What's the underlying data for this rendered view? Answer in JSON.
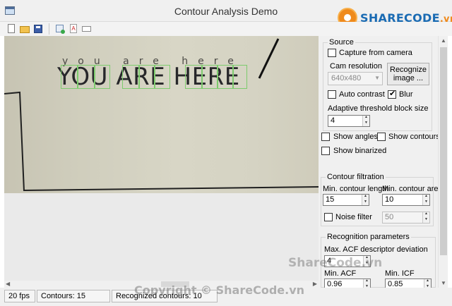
{
  "window": {
    "title": "Contour Analysis Demo",
    "logo": {
      "brand": "SHARECODE",
      "suffix": ".vn"
    }
  },
  "toolbar": {
    "items": [
      "new-file-icon",
      "open-folder-icon",
      "save-icon",
      "add-template-icon",
      "text-template-icon",
      "window-icon"
    ]
  },
  "image": {
    "small_text": "you are here",
    "big_text": "YOU ARE HERE"
  },
  "source": {
    "title": "Source",
    "capture_label": "Capture from camera",
    "capture_checked": false,
    "cam_resolution_label": "Cam resolution",
    "cam_resolution_value": "640x480",
    "recognize_button": "Recognize image ...",
    "auto_contrast_label": "Auto contrast",
    "auto_contrast_checked": false,
    "blur_label": "Blur",
    "blur_checked": true,
    "threshold_label": "Adaptive threshold block size",
    "threshold_value": "4"
  },
  "display": {
    "show_angles": "Show angles",
    "show_contours": "Show contours",
    "show_binarized": "Show binarized"
  },
  "filtration": {
    "title": "Contour filtration",
    "min_length_label": "Min. contour length",
    "min_length_value": "15",
    "min_area_label": "Min. contour area",
    "min_area_value": "10",
    "noise_filter_label": "Noise filter",
    "noise_filter_value": "50"
  },
  "recognition": {
    "title": "Recognition parameters",
    "max_acf_label": "Max. ACF descriptor deviation",
    "max_acf_value": "4",
    "min_acf_label": "Min. ACF",
    "min_acf_value": "0.96",
    "min_icf_label": "Min. ICF",
    "min_icf_value": "0.85"
  },
  "status": {
    "fps": "20 fps",
    "contours": "Contours: 15",
    "recognized": "Recognized contours: 10"
  },
  "watermarks": {
    "center": "ShareCode.vn",
    "bottom": "Copyright © ShareCode.vn"
  }
}
